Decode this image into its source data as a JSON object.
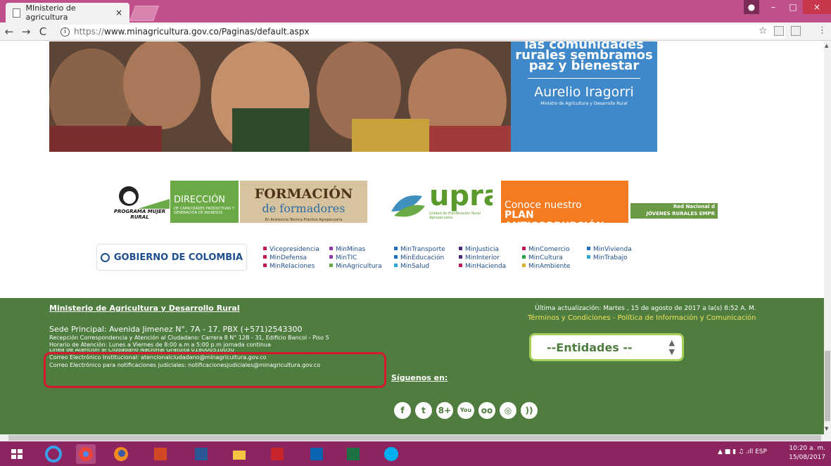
{
  "browser": {
    "tab_title": "MInisterio de agricultura",
    "tab_close": "×",
    "url_scheme": "https://",
    "url_rest": "www.minagricultura.gov.co/Paginas/default.aspx",
    "back": "←",
    "forward": "→",
    "reload": "C",
    "info": "i",
    "star": "☆",
    "menu": "⋮",
    "win_min": "–",
    "win_max": "□",
    "win_close": "×"
  },
  "banner": {
    "quote_l1": "las comunidades",
    "quote_l2": "rurales sembramos",
    "quote_l3": "paz y bienestar",
    "name": "Aurelio Iragorri",
    "role": "Ministro de Agricultura y Desarrollo Rural"
  },
  "logos": {
    "mujer": "PROGRAMA MUJER RURAL",
    "direccion": "DIRECCIÓN",
    "direccion_sub": "DE CAPACIDADES PRODUCTIVAS Y GENERACIÓN DE INGRESOS",
    "formacion_l1": "FORMACIÓN",
    "formacion_l2": "de formadores",
    "formacion_sub": "En Asistencia Técnica Práctica Agropecuaria",
    "upra": "upra",
    "upra_sub": "Unidad de Planificación Rural Agropecuaria",
    "anti_l1": "Conoce nuestro",
    "anti_l2": "PLAN ANTICORRUPCIÓN",
    "jovenes_l1": "Red Nacional d",
    "jovenes_l2": "JÓVENES RURALES EMPR"
  },
  "gobierno": "GOBIERNO DE COLOMBIA",
  "ministries": {
    "col1": [
      "Vicepresidencia",
      "MinDefensa",
      "MinRelaciones"
    ],
    "col2": [
      "MinMinas",
      "MinTIC",
      "MinAgricultura"
    ],
    "col3": [
      "MinTransporte",
      "MinEducación",
      "MinSalud"
    ],
    "col4": [
      "MinJusticia",
      "MinInterior",
      "MinHacienda"
    ],
    "col5": [
      "MinComercio",
      "MinCultura",
      "MinAmbiente"
    ],
    "col6": [
      "MinVivienda",
      "MinTrabajo"
    ]
  },
  "footer": {
    "title": "Ministerio de Agricultura y Desarrollo Rural",
    "sede": "Sede Principal: Avenida Jimenez N°. 7A - 17. PBX (+571)2543300",
    "recepcion": "Recepción Correspondencia y Atención al Ciudadano: Carrera 8 N° 12B - 31, Edificio Bancol - Piso 5",
    "horario": "Horario de Atención: Lunes a Viernes de 8:00 a.m a 5:00 p.m jornada continua",
    "linea": "Línea de Atención al Ciudadano Nacional Gratuita 018000510050",
    "correo_inst": "Correo Electrónico Institucional: atencionalciudadano@minagricultura.gov.co",
    "correo_jud": "Correo Electrónico para notificaciones judiciales: notificacionesjudiciales@minagricultura.gov.co",
    "siguenos": "Síguenos en:",
    "update": "Última actualización: Martes , 15 de agosto de 2017 a la(s) 8:52 A. M.",
    "links": "Términos y Condiciones - Política de Información y Comunicación",
    "entidades": "--Entidades --",
    "social": [
      "f",
      "t",
      "8+",
      "You",
      "oo",
      "◎",
      "))"
    ]
  },
  "taskbar": {
    "lang": "ESP",
    "time": "10:20 a. m.",
    "date": "15/08/2017"
  },
  "colors": {
    "footer_green": "#4f7d3f",
    "accent_red": "#d7192e",
    "taskbar": "#8c2460"
  }
}
